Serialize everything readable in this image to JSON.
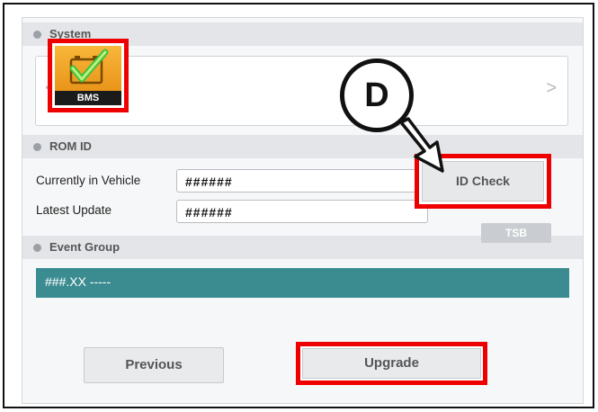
{
  "system": {
    "header": "System",
    "nav_prev": "<",
    "nav_next": ">",
    "tile": {
      "label": "BMS",
      "icon": "battery-check-icon"
    }
  },
  "rom_id": {
    "header": "ROM ID",
    "current_label": "Currently in Vehicle",
    "current_value": "######",
    "latest_label": "Latest Update",
    "latest_value": "######",
    "id_check_label": "ID Check"
  },
  "event_group": {
    "header": "Event Group",
    "tsb_label": "TSB",
    "selected_row": "###.XX -----"
  },
  "footer": {
    "previous_label": "Previous",
    "upgrade_label": "Upgrade"
  },
  "callout": {
    "letter": "D"
  },
  "colors": {
    "highlight": "#ee0000",
    "event_row": "#3b8c91",
    "tile_orange": "#f0a020"
  }
}
